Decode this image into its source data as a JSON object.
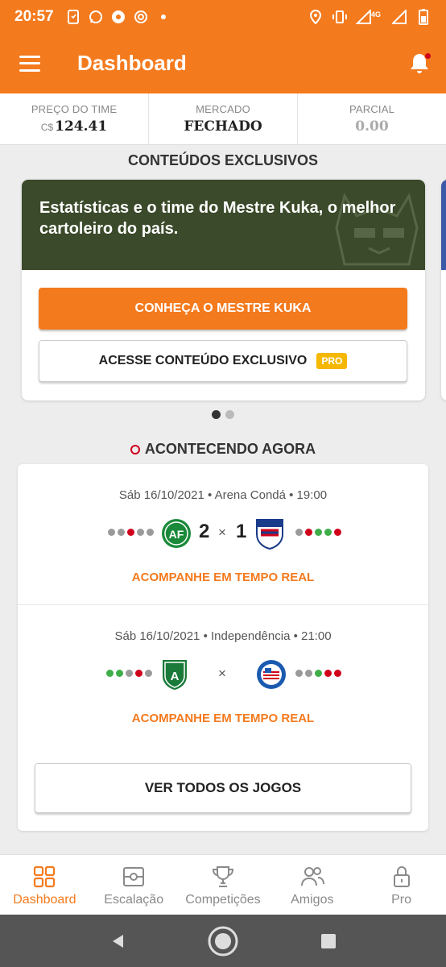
{
  "status_bar": {
    "time": "20:57",
    "network": "4G"
  },
  "app_bar": {
    "title": "Dashboard"
  },
  "stats": [
    {
      "label": "PREÇO DO TIME",
      "currency": "C$",
      "value": "124.41"
    },
    {
      "label": "MERCADO",
      "value": "FECHADO"
    },
    {
      "label": "PARCIAL",
      "value": "0.00"
    }
  ],
  "exclusive": {
    "section_title": "CONTEÚDOS EXCLUSIVOS",
    "banner_text": "Estatísticas e o time do Mestre Kuka, o melhor cartoleiro do país.",
    "primary_button": "CONHEÇA O MESTRE KUKA",
    "secondary_button": "ACESSE CONTEÚDO EXCLUSIVO",
    "badge": "PRO"
  },
  "live": {
    "section_title": "ACONTECENDO AGORA",
    "games": [
      {
        "meta": "Sáb 16/10/2021 • Arena Condá • 19:00",
        "home_score": "2",
        "separator": "×",
        "away_score": "1",
        "home_form": [
          "n",
          "n",
          "r",
          "n",
          "n"
        ],
        "away_form": [
          "n",
          "r",
          "g",
          "g",
          "r"
        ],
        "follow": "ACOMPANHE EM TEMPO REAL"
      },
      {
        "meta": "Sáb 16/10/2021 • Independência • 21:00",
        "home_score": "",
        "separator": "×",
        "away_score": "",
        "home_form": [
          "g",
          "g",
          "n",
          "r",
          "n"
        ],
        "away_form": [
          "n",
          "n",
          "g",
          "r",
          "r"
        ],
        "follow": "ACOMPANHE EM TEMPO REAL"
      }
    ],
    "all_games_button": "VER TODOS OS JOGOS"
  },
  "bottom_nav": [
    {
      "label": "Dashboard",
      "icon": "grid-icon",
      "active": true
    },
    {
      "label": "Escalação",
      "icon": "field-icon"
    },
    {
      "label": "Competições",
      "icon": "trophy-icon"
    },
    {
      "label": "Amigos",
      "icon": "people-icon"
    },
    {
      "label": "Pro",
      "icon": "lock-icon"
    }
  ],
  "colors": {
    "primary": "#f47a1e",
    "banner": "#3b4a2a",
    "win": "#3fae49",
    "loss": "#d0021b",
    "draw": "#9a9a9a",
    "badge": "#f5b700"
  }
}
